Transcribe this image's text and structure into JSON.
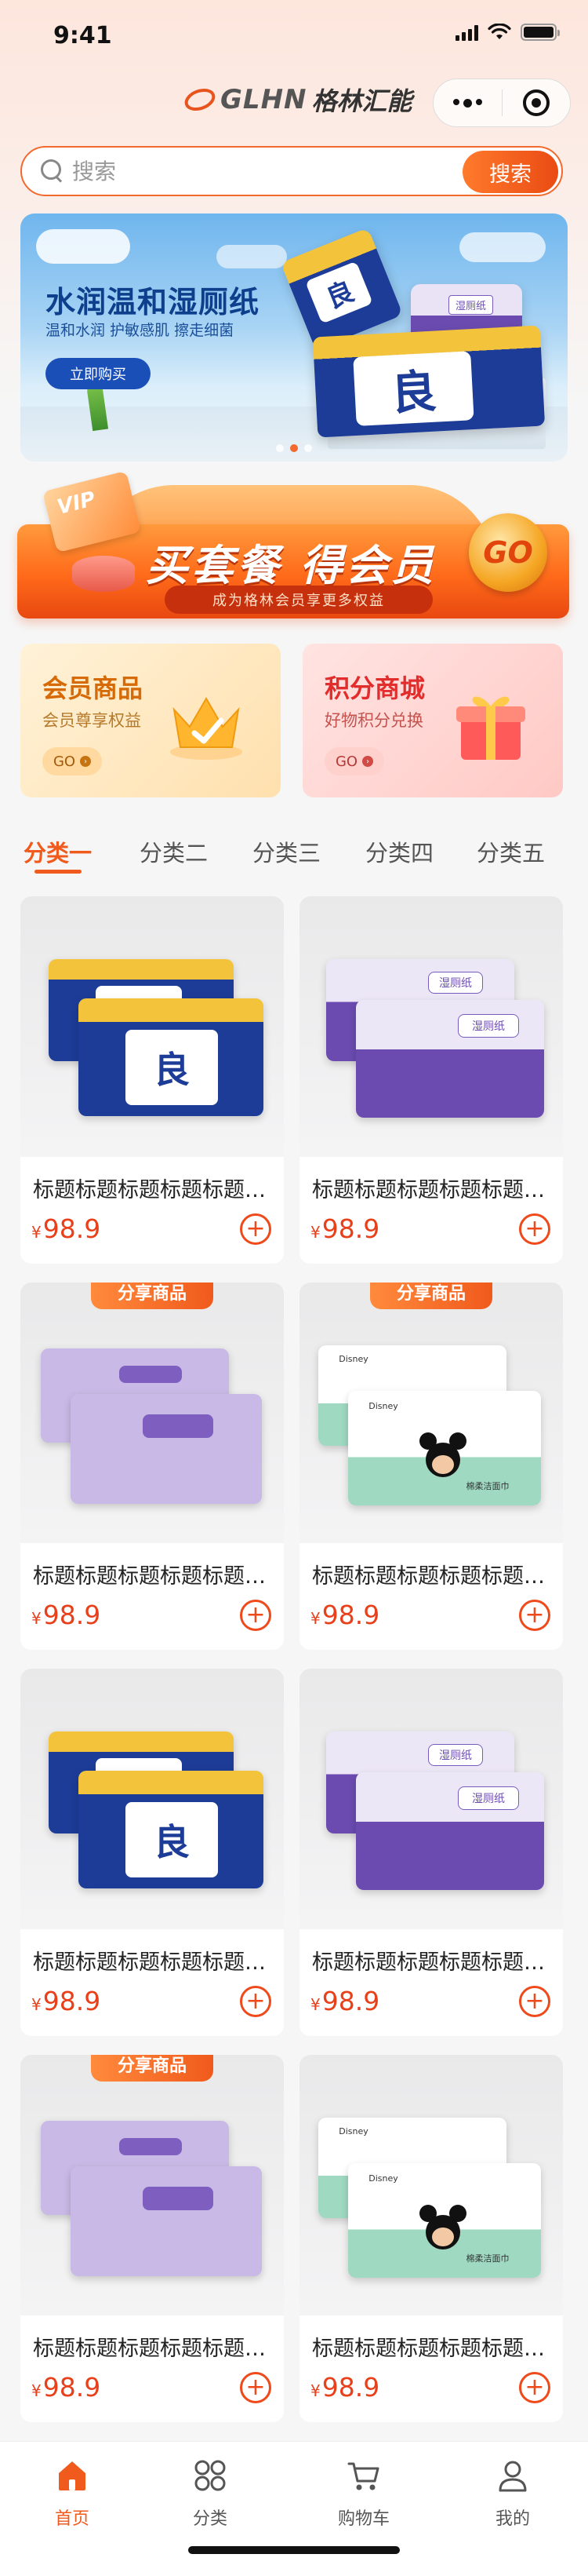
{
  "status_bar": {
    "time": "9:41"
  },
  "header": {
    "logo_mark": "GLHN",
    "logo_text": "格林汇能"
  },
  "search": {
    "placeholder": "搜索",
    "button_label": "搜索"
  },
  "banner": {
    "title": "水润温和湿厕纸",
    "subtitle": "温和水润 护敏感肌 擦走细菌",
    "button_label": "立即购买",
    "product_char": "良",
    "purple_tag": "湿厕纸",
    "page_count": 3,
    "active_page": 2
  },
  "promo": {
    "title": "买套餐 得会员",
    "subtitle": "成为格林会员享更多权益",
    "go": "GO",
    "vip": "VIP"
  },
  "cards": {
    "member": {
      "title": "会员商品",
      "subtitle": "会员尊享权益",
      "go": "GO"
    },
    "points": {
      "title": "积分商城",
      "subtitle": "好物积分兑换",
      "go": "GO"
    }
  },
  "tabs": [
    {
      "label": "分类一",
      "active": true
    },
    {
      "label": "分类二",
      "active": false
    },
    {
      "label": "分类三",
      "active": false
    },
    {
      "label": "分类四",
      "active": false
    },
    {
      "label": "分类五",
      "active": false
    }
  ],
  "products": [
    {
      "title": "标题标题标题标题标题标题",
      "currency": "¥",
      "price": "98.9",
      "image": "blue-wipes",
      "badge": ""
    },
    {
      "title": "标题标题标题标题标题标题",
      "currency": "¥",
      "price": "98.9",
      "image": "purple-wipes",
      "badge": ""
    },
    {
      "title": "标题标题标题标题标题标题",
      "currency": "¥",
      "price": "98.9",
      "image": "lavender-wipes",
      "badge": "分享商品"
    },
    {
      "title": "标题标题标题标题标题标题",
      "currency": "¥",
      "price": "98.9",
      "image": "disney-wipes",
      "badge": "分享商品"
    },
    {
      "title": "标题标题标题标题标题标题",
      "currency": "¥",
      "price": "98.9",
      "image": "blue-wipes",
      "badge": ""
    },
    {
      "title": "标题标题标题标题标题标题",
      "currency": "¥",
      "price": "98.9",
      "image": "purple-wipes",
      "badge": ""
    },
    {
      "title": "标题标题标题标题标题标题",
      "currency": "¥",
      "price": "98.9",
      "image": "lavender-wipes",
      "badge": "分享商品"
    },
    {
      "title": "标题标题标题标题标题标题",
      "currency": "¥",
      "price": "98.9",
      "image": "disney-wipes",
      "badge": ""
    }
  ],
  "product_labels": {
    "blue": "良",
    "purple": "湿厕纸",
    "disney_brand": "Disney",
    "disney_text": "棉柔洁面巾"
  },
  "tabbar": [
    {
      "label": "首页",
      "icon": "home-icon",
      "active": true
    },
    {
      "label": "分类",
      "icon": "category-icon",
      "active": false
    },
    {
      "label": "购物车",
      "icon": "cart-icon",
      "active": false
    },
    {
      "label": "我的",
      "icon": "user-icon",
      "active": false
    }
  ],
  "colors": {
    "accent": "#f05a1c",
    "price": "#e8401a",
    "banner_blue": "#0d3f8c"
  }
}
